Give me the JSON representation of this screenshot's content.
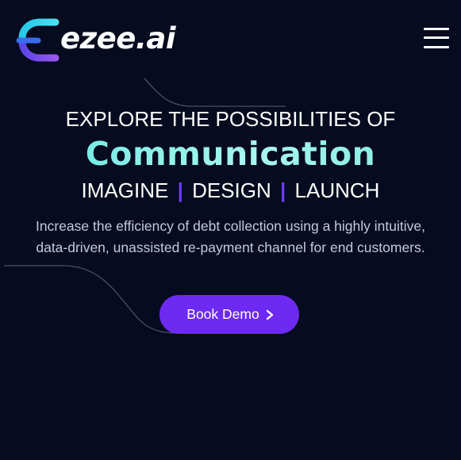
{
  "header": {
    "logo_text": "ezee.ai",
    "menu_icon": "hamburger-menu-icon"
  },
  "hero": {
    "eyebrow": "EXPLORE THE POSSIBILITIES OF",
    "title": "Communication",
    "tagline": {
      "word1": "IMAGINE",
      "separator": "|",
      "word2": "DESIGN",
      "word3": "LAUNCH"
    },
    "description": "Increase the efficiency of debt collection using a highly intuitive, data-driven, unassisted re-payment channel for end customers.",
    "cta_label": "Book Demo",
    "cta_icon": "chevron-right-icon"
  },
  "colors": {
    "background": "#060b1f",
    "accent_teal": "#7ff0ea",
    "accent_purple": "#6d2af2",
    "separator_purple": "#6d3cf5",
    "logo_cyan": "#2ec6f0",
    "logo_purple": "#7b4cf2",
    "logo_blue": "#3a6bf2",
    "text_muted": "#c7c9de"
  }
}
